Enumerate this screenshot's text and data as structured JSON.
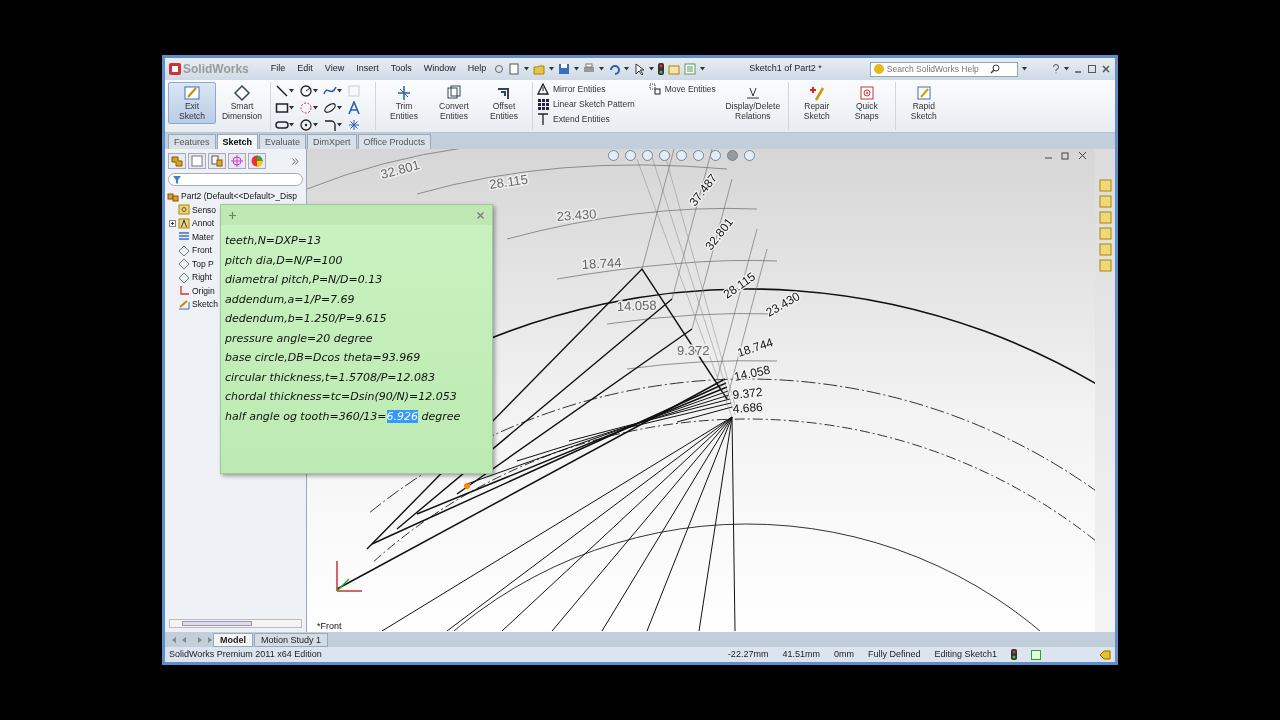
{
  "window": {
    "logo": "SolidWorks",
    "title": "Sketch1 of Part2 *"
  },
  "menu": [
    "File",
    "Edit",
    "View",
    "Insert",
    "Tools",
    "Window",
    "Help"
  ],
  "search": {
    "placeholder": "Search SolidWorks Help"
  },
  "ribbon": [
    {
      "kind": "big",
      "label": "Exit Sketch",
      "selected": true
    },
    {
      "kind": "big",
      "label": "Smart Dimension",
      "selected": false
    },
    {
      "kind": "tools"
    },
    {
      "kind": "big",
      "label": "Trim Entities",
      "selected": false
    },
    {
      "kind": "big",
      "label": "Convert Entities",
      "selected": false
    },
    {
      "kind": "big",
      "label": "Offset Entities",
      "selected": false
    },
    {
      "kind": "stack",
      "items": [
        "Mirror Entities",
        "Linear Sketch Pattern",
        "Extend Entities"
      ]
    },
    {
      "kind": "stack",
      "items": [
        "Move Entities"
      ]
    },
    {
      "kind": "big",
      "label": "Display/Delete Relations",
      "selected": false
    },
    {
      "kind": "big",
      "label": "Repair Sketch",
      "selected": false
    },
    {
      "kind": "big",
      "label": "Quick Snaps",
      "selected": false
    },
    {
      "kind": "big",
      "label": "Rapid Sketch",
      "selected": false
    }
  ],
  "command_tabs": [
    {
      "label": "Features",
      "selected": false
    },
    {
      "label": "Sketch",
      "selected": true
    },
    {
      "label": "Evaluate",
      "selected": false
    },
    {
      "label": "DimXpert",
      "selected": false
    },
    {
      "label": "Office Products",
      "selected": false
    }
  ],
  "feature_tree": {
    "root": "Part2  (Default<<Default>_Disp",
    "items": [
      {
        "label": "Senso",
        "expandable": false
      },
      {
        "label": "Annot",
        "expandable": true
      },
      {
        "label": "Mater",
        "expandable": false
      },
      {
        "label": "Front",
        "expandable": false
      },
      {
        "label": "Top P",
        "expandable": false
      },
      {
        "label": "Right",
        "expandable": false
      },
      {
        "label": "Origin",
        "expandable": false
      },
      {
        "label": "Sketch",
        "expandable": false
      }
    ]
  },
  "note": {
    "lines": [
      {
        "text": "teeth,N=DXP=13"
      },
      {
        "text": "pitch dia,D=N/P=100"
      },
      {
        "text": "diametral pitch,P=N/D=0.13"
      },
      {
        "text": "addendum,a=1/P=7.69"
      },
      {
        "text": "dedendum,b=1.250/P=9.615"
      },
      {
        "text": "pressure angle=20 degree"
      },
      {
        "text": "base circle,DB=Dcos theta=93.969"
      },
      {
        "text": "circular thickness,t=1.5708/P=12.083"
      },
      {
        "text": "chordal thickness=tc=Dsin(90/N)=12.053"
      },
      {
        "text": "half angle og tooth=360/13=",
        "highlight": "6.926",
        "after": " degree"
      }
    ]
  },
  "dimensions": {
    "angular": [
      "32.801",
      "28.115",
      "23.430",
      "18.744",
      "14.058",
      "9.372"
    ],
    "radial": [
      "37.487",
      "32.801",
      "28.115",
      "23.430",
      "18.744",
      "14.058",
      "9.372",
      "4.686"
    ]
  },
  "view_label": "*Front",
  "bottom_tabs": [
    {
      "label": "Model",
      "selected": true
    },
    {
      "label": "Motion Study 1",
      "selected": false
    }
  ],
  "status_bar": {
    "edition": "SolidWorks Premium 2011 x64 Edition",
    "x": "-22.27mm",
    "y": "41.51mm",
    "z": "0mm",
    "state": "Fully Defined",
    "mode": "Editing Sketch1"
  }
}
